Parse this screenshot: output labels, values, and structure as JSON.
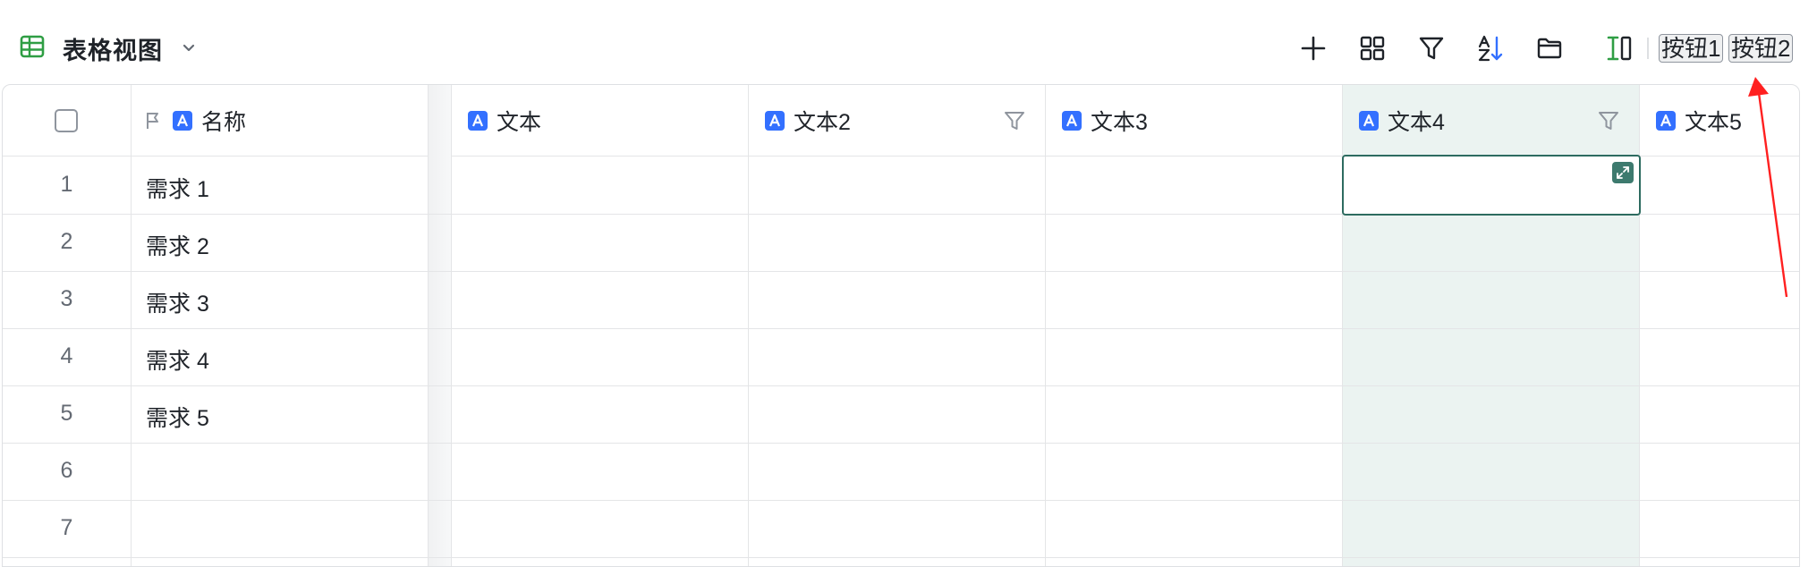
{
  "view": {
    "title": "表格视图",
    "icon": "table-grid-icon",
    "accent": "#2f9e44"
  },
  "toolbar": {
    "icons": [
      "plus-icon",
      "grid-layout-icon",
      "filter-icon",
      "sort-az-icon",
      "folder-icon",
      "column-resize-icon"
    ],
    "button1_label": "按钮1",
    "button2_label": "按钮2"
  },
  "columns": [
    {
      "name": "名称",
      "field_icon": "text-field-icon",
      "primary": true
    },
    {
      "name": "文本",
      "field_icon": "text-field-icon"
    },
    {
      "name": "文本2",
      "field_icon": "text-field-icon",
      "filtered": true
    },
    {
      "name": "文本3",
      "field_icon": "text-field-icon"
    },
    {
      "name": "文本4",
      "field_icon": "text-field-icon",
      "filtered": true,
      "highlighted": true
    },
    {
      "name": "文本5",
      "field_icon": "text-field-icon"
    }
  ],
  "rows": [
    {
      "num": "1",
      "name": "需求 1"
    },
    {
      "num": "2",
      "name": "需求 2"
    },
    {
      "num": "3",
      "name": "需求 3"
    },
    {
      "num": "4",
      "name": "需求 4"
    },
    {
      "num": "5",
      "name": "需求 5"
    },
    {
      "num": "6",
      "name": ""
    },
    {
      "num": "7",
      "name": ""
    }
  ],
  "colors": {
    "highlight_column": "#ebf3f1",
    "active_border": "#2d6b60",
    "field_icon_blue": "#3370ff",
    "annotation_arrow": "#ff2020"
  }
}
